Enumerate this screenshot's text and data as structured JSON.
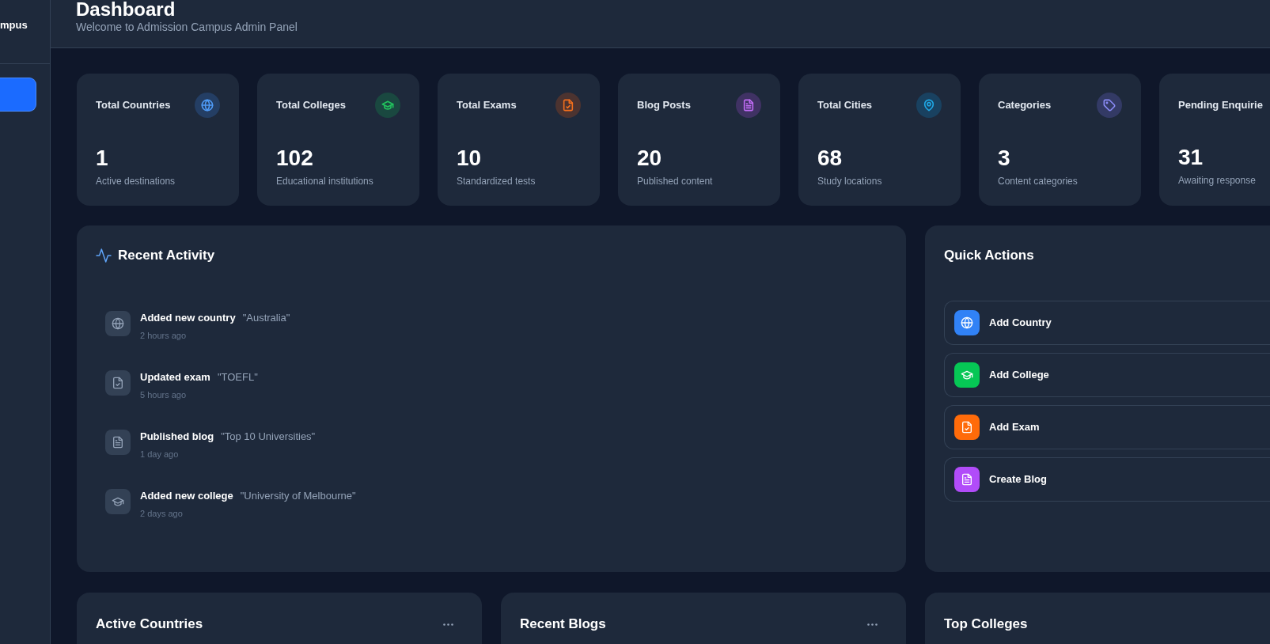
{
  "sidebar": {
    "brand": "mpus",
    "items": [
      {
        "selected": true
      }
    ]
  },
  "header": {
    "title": "Dashboard",
    "subtitle": "Welcome to Admission Campus Admin Panel"
  },
  "stats": [
    {
      "label": "Total Countries",
      "kind": "country",
      "color": "#4f9bf7",
      "value": "1",
      "caption": "Active destinations"
    },
    {
      "label": "Total Colleges",
      "kind": "college",
      "color": "#22c55e",
      "value": "102",
      "caption": "Educational institutions"
    },
    {
      "label": "Total Exams",
      "kind": "exam",
      "color": "#f36f1d",
      "value": "10",
      "caption": "Standardized tests"
    },
    {
      "label": "Blog Posts",
      "kind": "blog",
      "color": "#c06cf5",
      "value": "20",
      "caption": "Published content"
    },
    {
      "label": "Total Cities",
      "kind": "city",
      "color": "#1fa8e6",
      "value": "68",
      "caption": "Study locations"
    },
    {
      "label": "Categories",
      "kind": "category",
      "color": "#8b8cf8",
      "value": "3",
      "caption": "Content categories"
    },
    {
      "label": "Pending Enquirie",
      "value": "31",
      "caption": "Awaiting response"
    }
  ],
  "recent_activity": {
    "title": "Recent Activity",
    "items": [
      {
        "kind": "country",
        "action": "Added new country",
        "target": "\"Australia\"",
        "time": "2 hours ago"
      },
      {
        "kind": "exam",
        "action": "Updated exam",
        "target": "\"TOEFL\"",
        "time": "5 hours ago"
      },
      {
        "kind": "blog",
        "action": "Published blog",
        "target": "\"Top 10 Universities\"",
        "time": "1 day ago"
      },
      {
        "kind": "college",
        "action": "Added new college",
        "target": "\"University of Melbourne\"",
        "time": "2 days ago"
      }
    ]
  },
  "quick_actions": {
    "title": "Quick Actions",
    "items": [
      {
        "kind": "country",
        "color": "#3182f6",
        "label": "Add Country"
      },
      {
        "kind": "college",
        "color": "#06c755",
        "label": "Add College"
      },
      {
        "kind": "exam",
        "color": "#ff6b0a",
        "label": "Add Exam"
      },
      {
        "kind": "blog",
        "color": "#b14cf9",
        "label": "Create Blog"
      }
    ]
  },
  "panels": [
    {
      "title": "Active Countries",
      "menu": true
    },
    {
      "title": "Recent Blogs",
      "menu": true
    },
    {
      "title": "Top Colleges",
      "menu": false
    }
  ]
}
